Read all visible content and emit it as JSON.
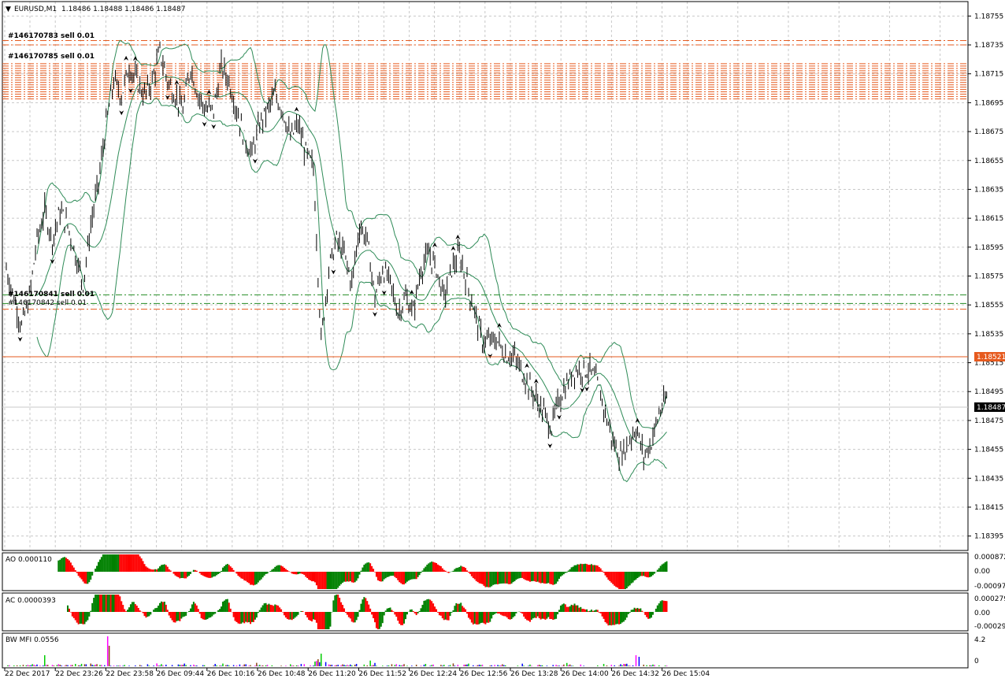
{
  "header": {
    "title": "EURUSD,M1",
    "ohlc": "1.18486 1.18488 1.18486 1.18487"
  },
  "colors": {
    "background": "#ffffff",
    "grid": "#c8c8c8",
    "bollinger": "#2e8b57",
    "ask_line": "#e65a1e",
    "bid_tag": "#000000",
    "order_sell": "#e65a1e",
    "order_green": "#228b22",
    "ao_up": "#008000",
    "ao_down": "#ff0000",
    "bwmfi_blue": "#0000ff",
    "bwmfi_green": "#00cc00",
    "bwmfi_pink": "#ff00ff"
  },
  "chart_data": [
    {
      "type": "ohlc",
      "panel": "main",
      "symbol": "EURUSD",
      "timeframe": "M1",
      "ylim": [
        1.18385,
        1.18765
      ],
      "yticks": [
        "1.18755",
        "1.18735",
        "1.18715",
        "1.18695",
        "1.18675",
        "1.18655",
        "1.18635",
        "1.18615",
        "1.18595",
        "1.18575",
        "1.18555",
        "1.18535",
        "1.18515",
        "1.18495",
        "1.18475",
        "1.18455",
        "1.18435",
        "1.18415",
        "1.18395"
      ],
      "xticks": [
        "22 Dec 2017",
        "22 Dec 23:26",
        "22 Dec 23:58",
        "26 Dec 09:44",
        "26 Dec 10:16",
        "26 Dec 10:48",
        "26 Dec 11:20",
        "26 Dec 11:52",
        "26 Dec 12:24",
        "26 Dec 12:56",
        "26 Dec 13:28",
        "26 Dec 14:00",
        "26 Dec 14:32",
        "26 Dec 15:04"
      ],
      "ask_price": "1.18521",
      "bid_price": "1.18487",
      "close_path": [
        [
          0,
          1.1858
        ],
        [
          5,
          1.1856
        ],
        [
          10,
          1.1854
        ],
        [
          15,
          1.1856
        ],
        [
          20,
          1.186
        ],
        [
          25,
          1.1862
        ],
        [
          30,
          1.186
        ],
        [
          35,
          1.1862
        ],
        [
          40,
          1.1861
        ],
        [
          45,
          1.1859
        ],
        [
          50,
          1.1857
        ],
        [
          55,
          1.1861
        ],
        [
          60,
          1.1864
        ],
        [
          65,
          1.1868
        ],
        [
          70,
          1.1871
        ],
        [
          75,
          1.187
        ],
        [
          80,
          1.1872
        ],
        [
          85,
          1.1871
        ],
        [
          90,
          1.187
        ],
        [
          95,
          1.1871
        ],
        [
          100,
          1.1873
        ],
        [
          105,
          1.1871
        ],
        [
          110,
          1.187
        ],
        [
          115,
          1.1869
        ],
        [
          120,
          1.1872
        ],
        [
          125,
          1.187
        ],
        [
          130,
          1.1869
        ],
        [
          135,
          1.1869
        ],
        [
          140,
          1.1872
        ],
        [
          145,
          1.1871
        ],
        [
          150,
          1.1869
        ],
        [
          155,
          1.1867
        ],
        [
          160,
          1.1866
        ],
        [
          165,
          1.1868
        ],
        [
          170,
          1.1869
        ],
        [
          175,
          1.187
        ],
        [
          180,
          1.1869
        ],
        [
          185,
          1.1867
        ],
        [
          190,
          1.1868
        ],
        [
          195,
          1.1866
        ],
        [
          200,
          1.1865
        ],
        [
          205,
          1.1853
        ],
        [
          210,
          1.1858
        ],
        [
          215,
          1.186
        ],
        [
          220,
          1.1859
        ],
        [
          225,
          1.1857
        ],
        [
          230,
          1.1861
        ],
        [
          235,
          1.186
        ],
        [
          240,
          1.1856
        ],
        [
          245,
          1.1858
        ],
        [
          250,
          1.1857
        ],
        [
          255,
          1.1855
        ],
        [
          260,
          1.1856
        ],
        [
          265,
          1.1855
        ],
        [
          270,
          1.1858
        ],
        [
          275,
          1.1859
        ],
        [
          280,
          1.1858
        ],
        [
          285,
          1.1856
        ],
        [
          290,
          1.1858
        ],
        [
          295,
          1.1859
        ],
        [
          300,
          1.1857
        ],
        [
          305,
          1.1855
        ],
        [
          310,
          1.1853
        ],
        [
          315,
          1.1853
        ],
        [
          320,
          1.1853
        ],
        [
          325,
          1.1852
        ],
        [
          330,
          1.1852
        ],
        [
          335,
          1.1851
        ],
        [
          340,
          1.185
        ],
        [
          345,
          1.1849
        ],
        [
          350,
          1.1848
        ],
        [
          355,
          1.1847
        ],
        [
          360,
          1.1849
        ],
        [
          365,
          1.185
        ],
        [
          370,
          1.1851
        ],
        [
          375,
          1.1851
        ],
        [
          380,
          1.1851
        ],
        [
          385,
          1.185
        ],
        [
          390,
          1.1848
        ],
        [
          395,
          1.1846
        ],
        [
          400,
          1.1845
        ],
        [
          405,
          1.1846
        ],
        [
          410,
          1.1847
        ],
        [
          415,
          1.1845
        ],
        [
          420,
          1.1846
        ],
        [
          425,
          1.1848
        ],
        [
          430,
          1.1849
        ]
      ]
    },
    {
      "type": "histogram",
      "panel": "AO",
      "label": "AO 0.000110",
      "yticks": [
        "0.000872",
        "0.00",
        "-0.000979"
      ]
    },
    {
      "type": "histogram",
      "panel": "AC",
      "label": "AC 0.0000393",
      "yticks": [
        "0.000279",
        "0.00",
        "-0.000291"
      ]
    },
    {
      "type": "histogram",
      "panel": "BWMFI",
      "label": "BW MFI 0.0556",
      "yticks": [
        "4.2",
        "0"
      ]
    }
  ],
  "order_labels": {
    "top_group": "#146170783 sell 0.01",
    "top_group2": "#146170785 sell 0.01",
    "bottom_group": "#146170841 sell 0.01",
    "bottom_group2": "#146170842 sell 0.01"
  }
}
